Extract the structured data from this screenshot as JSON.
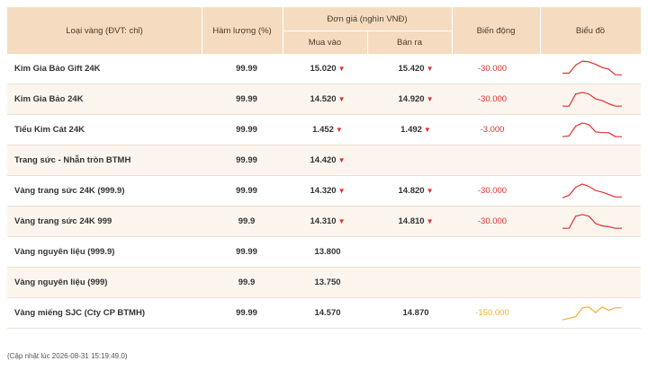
{
  "header": {
    "col_type": "Loại vàng (ĐVT: chỉ)",
    "col_purity": "Hàm lượng (%)",
    "col_price_group": "Đơn giá (nghìn VNĐ)",
    "col_buy": "Mua vào",
    "col_sell": "Bán ra",
    "col_change": "Biến động",
    "col_chart": "Biểu đồ"
  },
  "rows": [
    {
      "name": "Kim Gia Bảo Gift 24K",
      "purity": "99.99",
      "buy": "15.020",
      "buy_down": true,
      "sell": "15.420",
      "sell_down": true,
      "change": "-30.000",
      "change_color": "#e03030",
      "spark": [
        0.25,
        0.25,
        0.75,
        1.0,
        0.95,
        0.8,
        0.6,
        0.5,
        0.15,
        0.15
      ],
      "spark_color": "#e03030"
    },
    {
      "name": "Kim Gia Bảo 24K",
      "purity": "99.99",
      "buy": "14.520",
      "buy_down": true,
      "sell": "14.920",
      "sell_down": true,
      "change": "-30.000",
      "change_color": "#e03030",
      "spark": [
        0.1,
        0.1,
        0.85,
        0.95,
        0.85,
        0.55,
        0.45,
        0.25,
        0.1,
        0.1
      ],
      "spark_color": "#e03030"
    },
    {
      "name": "Tiểu Kim Cát 24K",
      "purity": "99.99",
      "buy": "1.452",
      "buy_down": true,
      "sell": "1.492",
      "sell_down": true,
      "change": "-3.000",
      "change_color": "#e03030",
      "spark": [
        0.1,
        0.15,
        0.75,
        0.95,
        0.85,
        0.4,
        0.35,
        0.35,
        0.1,
        0.1
      ],
      "spark_color": "#e03030"
    },
    {
      "name": "Trang sức - Nhẫn tròn BTMH",
      "purity": "99.99",
      "buy": "14.420",
      "buy_down": true,
      "sell": "",
      "sell_down": false,
      "change": "",
      "change_color": "#e03030",
      "spark": [],
      "spark_color": "#e03030"
    },
    {
      "name": "Vàng trang sức 24K (999.9)",
      "purity": "99.99",
      "buy": "14.320",
      "buy_down": true,
      "sell": "14.820",
      "sell_down": true,
      "change": "-30.000",
      "change_color": "#e03030",
      "spark": [
        0.1,
        0.25,
        0.75,
        0.95,
        0.8,
        0.55,
        0.45,
        0.3,
        0.15,
        0.15
      ],
      "spark_color": "#e03030"
    },
    {
      "name": "Vàng trang sức 24K 999",
      "purity": "99.9",
      "buy": "14.310",
      "buy_down": true,
      "sell": "14.810",
      "sell_down": true,
      "change": "-30.000",
      "change_color": "#e03030",
      "spark": [
        0.1,
        0.1,
        0.85,
        0.95,
        0.85,
        0.4,
        0.25,
        0.2,
        0.1,
        0.1
      ],
      "spark_color": "#e03030"
    },
    {
      "name": "Vàng nguyên liệu (999.9)",
      "purity": "99.99",
      "buy": "13.800",
      "buy_down": false,
      "sell": "",
      "sell_down": false,
      "change": "",
      "change_color": "#e03030",
      "spark": [],
      "spark_color": "#e03030"
    },
    {
      "name": "Vàng nguyên liệu (999)",
      "purity": "99.9",
      "buy": "13.750",
      "buy_down": false,
      "sell": "",
      "sell_down": false,
      "change": "",
      "change_color": "#e03030",
      "spark": [],
      "spark_color": "#e03030"
    },
    {
      "name": "Vàng miếng SJC (Cty CP BTMH)",
      "purity": "99.99",
      "buy": "14.570",
      "buy_down": false,
      "sell": "14.870",
      "sell_down": false,
      "change": "-150.000",
      "change_color": "#f0b030",
      "spark": [
        0.1,
        0.2,
        0.3,
        0.85,
        0.9,
        0.55,
        0.9,
        0.7,
        0.85,
        0.85
      ],
      "spark_color": "#f0b030"
    }
  ],
  "footer": "(Cập nhật lúc 2026-08-31 15:19:49.0)"
}
